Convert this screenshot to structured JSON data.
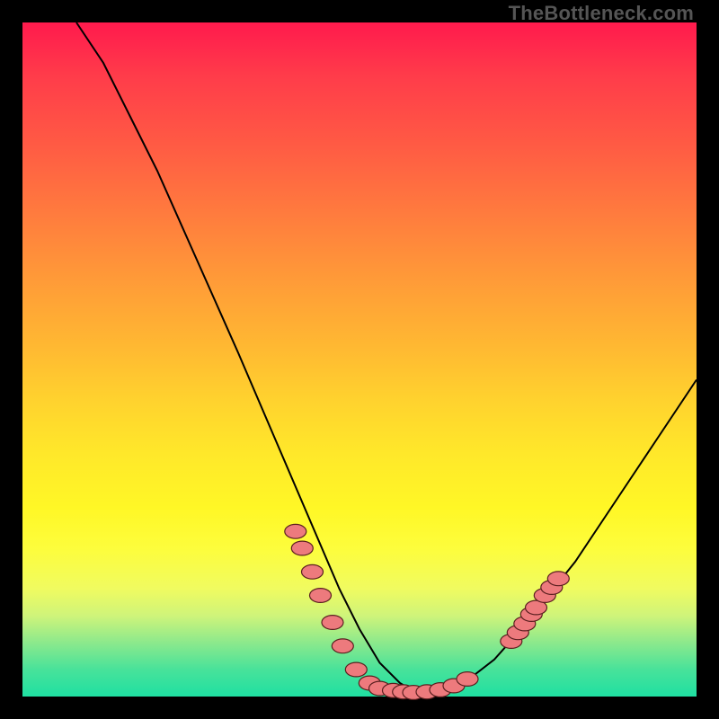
{
  "watermark": "TheBottleneck.com",
  "colors": {
    "dot_fill": "#ed7a7d",
    "dot_stroke": "#5a1f1f",
    "curve_stroke": "#000000",
    "frame_bg": "#000000"
  },
  "chart_data": {
    "type": "line",
    "title": "",
    "xlabel": "",
    "ylabel": "",
    "xlim": [
      0,
      100
    ],
    "ylim": [
      0,
      100
    ],
    "grid": false,
    "legend": false,
    "series": [
      {
        "name": "bottleneck-curve",
        "x": [
          8,
          12,
          16,
          20,
          24,
          28,
          32,
          35,
          38,
          41,
          44,
          47,
          50,
          53,
          56,
          58,
          60,
          63,
          66,
          70,
          74,
          78,
          82,
          86,
          90,
          94,
          98,
          100
        ],
        "y": [
          100,
          94,
          86,
          78,
          69,
          60,
          51,
          44,
          37,
          30,
          23,
          16,
          10,
          5,
          2,
          0.8,
          0.6,
          1.0,
          2.4,
          5.5,
          10,
          15,
          20,
          26,
          32,
          38,
          44,
          47
        ]
      }
    ],
    "markers": [
      {
        "x": 40.5,
        "y": 24.5
      },
      {
        "x": 41.5,
        "y": 22.0
      },
      {
        "x": 43.0,
        "y": 18.5
      },
      {
        "x": 44.2,
        "y": 15.0
      },
      {
        "x": 46.0,
        "y": 11.0
      },
      {
        "x": 47.5,
        "y": 7.5
      },
      {
        "x": 49.5,
        "y": 4.0
      },
      {
        "x": 51.5,
        "y": 2.0
      },
      {
        "x": 53.0,
        "y": 1.2
      },
      {
        "x": 55.0,
        "y": 0.9
      },
      {
        "x": 56.5,
        "y": 0.7
      },
      {
        "x": 58.0,
        "y": 0.6
      },
      {
        "x": 60.0,
        "y": 0.7
      },
      {
        "x": 62.0,
        "y": 1.0
      },
      {
        "x": 64.0,
        "y": 1.6
      },
      {
        "x": 66.0,
        "y": 2.6
      },
      {
        "x": 72.5,
        "y": 8.2
      },
      {
        "x": 73.5,
        "y": 9.5
      },
      {
        "x": 74.5,
        "y": 10.8
      },
      {
        "x": 75.5,
        "y": 12.2
      },
      {
        "x": 76.2,
        "y": 13.2
      },
      {
        "x": 77.5,
        "y": 15.0
      },
      {
        "x": 78.5,
        "y": 16.2
      },
      {
        "x": 79.5,
        "y": 17.5
      }
    ],
    "marker_rx": 1.6,
    "marker_ry": 1.05
  }
}
